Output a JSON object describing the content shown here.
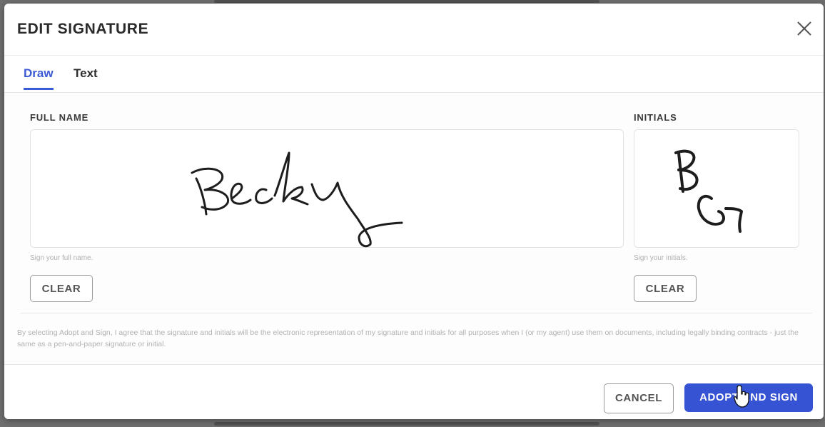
{
  "dialog": {
    "title": "EDIT SIGNATURE",
    "close_icon": "close-icon"
  },
  "tabs": [
    {
      "label": "Draw",
      "active": true
    },
    {
      "label": "Text",
      "active": false
    }
  ],
  "full_name": {
    "label": "FULL NAME",
    "hint": "Sign your full name.",
    "clear_label": "CLEAR"
  },
  "initials": {
    "label": "INITIALS",
    "hint": "Sign your initials.",
    "clear_label": "CLEAR"
  },
  "legal_text": "By selecting Adopt and Sign, I agree that the signature and initials will be the electronic representation of my signature and initials for all purposes when I (or my agent) use them on documents, including legally binding contracts - just the same as a pen-and-paper signature or initial.",
  "footer": {
    "cancel_label": "CANCEL",
    "adopt_label": "ADOPT AND SIGN"
  },
  "colors": {
    "accent": "#3553d3",
    "tab_active": "#3b5bd6"
  },
  "icons": {
    "cursor": "hand-pointer-icon"
  }
}
